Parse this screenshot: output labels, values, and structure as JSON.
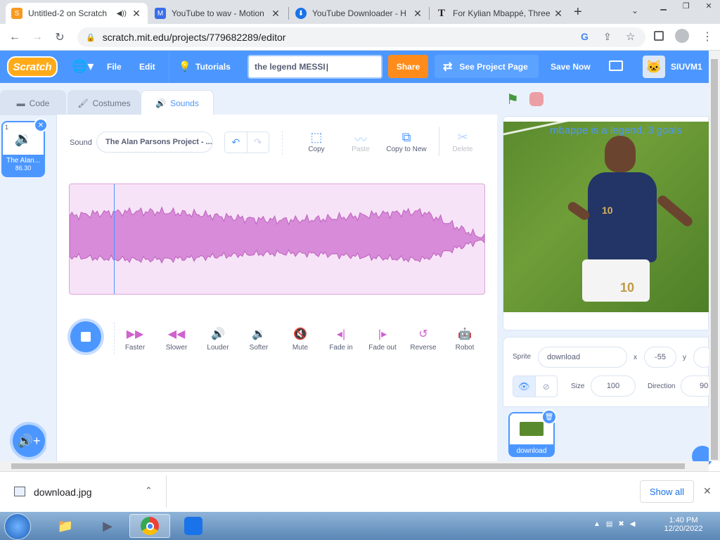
{
  "browser": {
    "tabs": [
      {
        "title": "Untitled-2 on Scratch",
        "favicon_color": "#f79a1f"
      },
      {
        "title": "YouTube to wav - Motion",
        "favicon_color": "#3a6ee8"
      },
      {
        "title": "YouTube Downloader - H",
        "favicon_color": "#1a73e8"
      },
      {
        "title": "For Kylian Mbappé, Three",
        "favicon_color": "#202124"
      }
    ],
    "url": "scratch.mit.edu/projects/779682289/editor"
  },
  "menu": {
    "logo": "Scratch",
    "file": "File",
    "edit": "Edit",
    "tutorials": "Tutorials",
    "project_title": "the legend MESSI",
    "share": "Share",
    "see_project": "See Project Page",
    "save_now": "Save Now",
    "username": "SIUVM1"
  },
  "tabs": {
    "code": "Code",
    "costumes": "Costumes",
    "sounds": "Sounds"
  },
  "sound_list": [
    {
      "index": "1",
      "name": "The Alan...",
      "length": "86.30"
    }
  ],
  "sound_editor": {
    "sound_label": "Sound",
    "sound_name": "The Alan Parsons Project - ...",
    "tools": {
      "copy": "Copy",
      "paste": "Paste",
      "copy_to_new": "Copy to New",
      "delete": "Delete"
    },
    "effects": [
      {
        "label": "Faster",
        "icon": "▶▶"
      },
      {
        "label": "Slower",
        "icon": "◀◀"
      },
      {
        "label": "Louder",
        "icon": "🔊"
      },
      {
        "label": "Softer",
        "icon": "🔉"
      },
      {
        "label": "Mute",
        "icon": "🔇"
      },
      {
        "label": "Fade in",
        "icon": "◂|"
      },
      {
        "label": "Fade out",
        "icon": "|▸"
      },
      {
        "label": "Reverse",
        "icon": "↺"
      },
      {
        "label": "Robot",
        "icon": "🤖"
      }
    ]
  },
  "stage": {
    "overlay_text": "mbappe is a legend, 3 goals"
  },
  "sprite_info": {
    "sprite_label": "Sprite",
    "sprite_name": "download",
    "x_label": "x",
    "x_value": "-55",
    "y_label": "y",
    "size_label": "Size",
    "size_value": "100",
    "direction_label": "Direction",
    "direction_value": "90"
  },
  "sprites": [
    {
      "name": "download"
    }
  ],
  "download_bar": {
    "file": "download.jpg",
    "show_all": "Show all"
  },
  "taskbar": {
    "time": "1:40 PM",
    "date": "12/20/2022"
  },
  "colors": {
    "scratch_blue": "#4c97ff",
    "share_orange": "#ff8c1a",
    "sound_pink": "#cf63cf"
  }
}
